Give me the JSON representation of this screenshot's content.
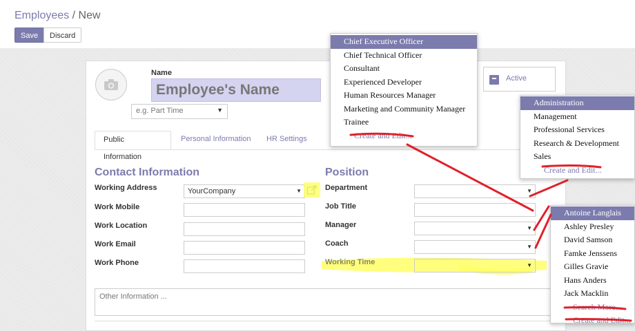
{
  "breadcrumb": {
    "parent": "Employees",
    "separator": "/",
    "current": "New"
  },
  "toolbar": {
    "save_label": "Save",
    "discard_label": "Discard"
  },
  "form": {
    "name_label": "Name",
    "name_placeholder": "Employee's Name",
    "tags_placeholder": "e.g. Part Time",
    "status_label": "Active"
  },
  "tabs": [
    "Public Information",
    "Personal Information",
    "HR Settings"
  ],
  "contact": {
    "title": "Contact Information",
    "fields": [
      {
        "label": "Working Address",
        "value": "YourCompany"
      },
      {
        "label": "Work Mobile",
        "value": ""
      },
      {
        "label": "Work Location",
        "value": ""
      },
      {
        "label": "Work Email",
        "value": ""
      },
      {
        "label": "Work Phone",
        "value": ""
      }
    ]
  },
  "position": {
    "title": "Position",
    "fields": [
      {
        "label": "Department",
        "value": ""
      },
      {
        "label": "Job Title",
        "value": ""
      },
      {
        "label": "Manager",
        "value": ""
      },
      {
        "label": "Coach",
        "value": ""
      },
      {
        "label": "Working Time",
        "value": ""
      }
    ]
  },
  "notes_placeholder": "Other Information ...",
  "job_dropdown": {
    "items": [
      "Chief Executive Officer",
      "Chief Technical Officer",
      "Consultant",
      "Experienced Developer",
      "Human Resources Manager",
      "Marketing and Community Manager",
      "Trainee"
    ],
    "create_label": "Create and Edit..."
  },
  "department_dropdown": {
    "items": [
      "Administration",
      "Management",
      "Professional Services",
      "Research & Development",
      "Sales"
    ],
    "create_label": "Create and Edit..."
  },
  "manager_dropdown": {
    "items": [
      "Antoine Langlais",
      "Ashley Presley",
      "David Samson",
      "Famke Jenssens",
      "Gilles Gravie",
      "Hans Anders",
      "Jack Macklin"
    ],
    "search_label": "Search More...",
    "create_label": "Create and Edit..."
  },
  "colors": {
    "accent": "#7c7bad",
    "highlight": "#ffff66",
    "annotation": "#e0202a"
  }
}
